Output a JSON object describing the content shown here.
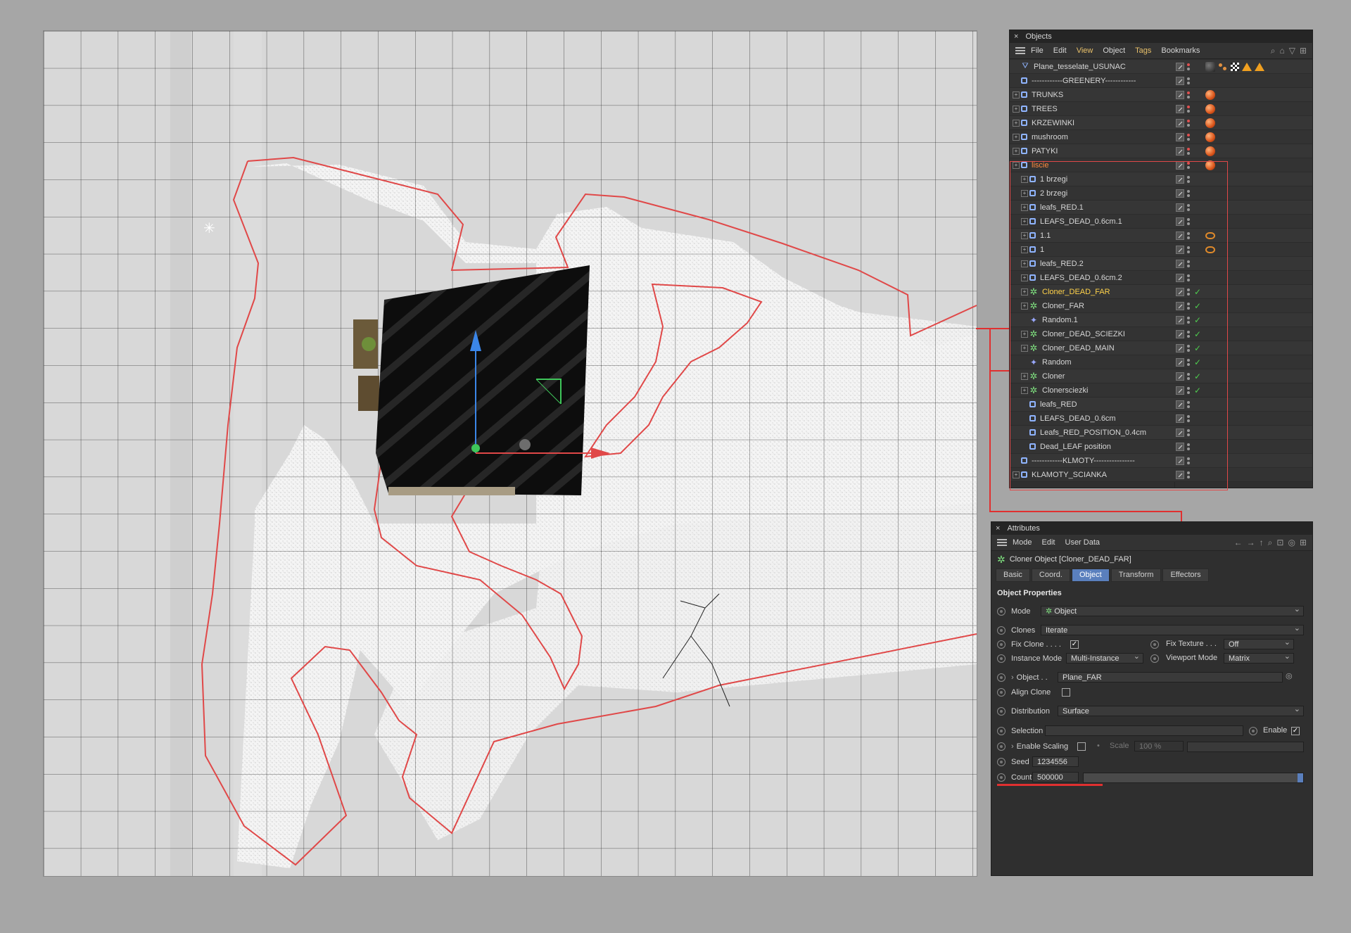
{
  "objects_panel": {
    "title": "Objects",
    "menu": [
      "File",
      "Edit",
      "View",
      "Object",
      "Tags",
      "Bookmarks"
    ],
    "rows": [
      {
        "name": "Plane_tesselate_USUNAC",
        "icon": "plane",
        "expand": false,
        "indent": 0,
        "tags": [
          "dark",
          "dots",
          "checker",
          "tri",
          "tri"
        ],
        "red": true
      },
      {
        "name": "------------GREENERY------------",
        "icon": "null",
        "expand": false,
        "indent": 0,
        "tags": []
      },
      {
        "name": "TRUNKS",
        "icon": "null",
        "expand": true,
        "indent": 0,
        "tags": [
          "mat"
        ],
        "red": true
      },
      {
        "name": "TREES",
        "icon": "null",
        "expand": true,
        "indent": 0,
        "tags": [
          "mat"
        ],
        "red": true
      },
      {
        "name": "KRZEWINKI",
        "icon": "null",
        "expand": true,
        "indent": 0,
        "tags": [
          "mat"
        ],
        "red": true
      },
      {
        "name": "mushroom",
        "icon": "null",
        "expand": true,
        "indent": 0,
        "tags": [
          "mat"
        ],
        "red": true
      },
      {
        "name": "PATYKI",
        "icon": "null",
        "expand": true,
        "indent": 0,
        "tags": [
          "mat"
        ],
        "red": true
      },
      {
        "name": "liscie",
        "icon": "null",
        "expand": true,
        "indent": 0,
        "tags": [
          "mat"
        ],
        "color": "orange",
        "red": true
      },
      {
        "name": "1 brzegi",
        "icon": "null",
        "expand": true,
        "indent": 1,
        "tags": []
      },
      {
        "name": "2 brzegi",
        "icon": "null",
        "expand": true,
        "indent": 1,
        "tags": []
      },
      {
        "name": "leafs_RED.1",
        "icon": "null",
        "expand": true,
        "indent": 1,
        "tags": []
      },
      {
        "name": "LEAFS_DEAD_0.6cm.1",
        "icon": "null",
        "expand": true,
        "indent": 1,
        "tags": []
      },
      {
        "name": "1.1",
        "icon": "null",
        "expand": true,
        "indent": 1,
        "tags": [
          "eye"
        ]
      },
      {
        "name": "1",
        "icon": "null",
        "expand": true,
        "indent": 1,
        "tags": [
          "eye"
        ]
      },
      {
        "name": "leafs_RED.2",
        "icon": "null",
        "expand": true,
        "indent": 1,
        "tags": []
      },
      {
        "name": "LEAFS_DEAD_0.6cm.2",
        "icon": "null",
        "expand": true,
        "indent": 1,
        "tags": []
      },
      {
        "name": "Cloner_DEAD_FAR",
        "icon": "cloner",
        "expand": true,
        "indent": 1,
        "tags": [],
        "color": "yellow",
        "check": true
      },
      {
        "name": "Cloner_FAR",
        "icon": "cloner",
        "expand": true,
        "indent": 1,
        "tags": [],
        "check": true
      },
      {
        "name": "Random.1",
        "icon": "random",
        "expand": false,
        "indent": 1,
        "tags": [],
        "check": true
      },
      {
        "name": "Cloner_DEAD_SCIEZKI",
        "icon": "cloner",
        "expand": true,
        "indent": 1,
        "tags": [],
        "check": true
      },
      {
        "name": "Cloner_DEAD_MAIN",
        "icon": "cloner",
        "expand": true,
        "indent": 1,
        "tags": [],
        "check": true
      },
      {
        "name": "Random",
        "icon": "random",
        "expand": false,
        "indent": 1,
        "tags": [],
        "check": true
      },
      {
        "name": "Cloner",
        "icon": "cloner",
        "expand": true,
        "indent": 1,
        "tags": [],
        "check": true
      },
      {
        "name": "Clonersciezki",
        "icon": "cloner",
        "expand": true,
        "indent": 1,
        "tags": [],
        "check": true
      },
      {
        "name": "leafs_RED",
        "icon": "null",
        "expand": false,
        "indent": 1,
        "tags": []
      },
      {
        "name": "LEAFS_DEAD_0.6cm",
        "icon": "null",
        "expand": false,
        "indent": 1,
        "tags": []
      },
      {
        "name": "Leafs_RED_POSITION_0.4cm",
        "icon": "null",
        "expand": false,
        "indent": 1,
        "tags": []
      },
      {
        "name": "Dead_LEAF position",
        "icon": "null",
        "expand": false,
        "indent": 1,
        "tags": []
      },
      {
        "name": "------------KLMOTY----------------",
        "icon": "null",
        "expand": false,
        "indent": 0,
        "tags": []
      },
      {
        "name": "KLAMOTY_SCIANKA",
        "icon": "null",
        "expand": true,
        "indent": 0,
        "tags": []
      }
    ]
  },
  "attributes_panel": {
    "title": "Attributes",
    "menu": [
      "Mode",
      "Edit",
      "User Data"
    ],
    "object_header": "Cloner Object [Cloner_DEAD_FAR]",
    "tabs": [
      "Basic",
      "Coord.",
      "Object",
      "Transform",
      "Effectors"
    ],
    "active_tab": "Object",
    "section": "Object Properties",
    "mode_label": "Mode",
    "mode_value": "Object",
    "clones_label": "Clones",
    "clones_value": "Iterate",
    "fix_clone_label": "Fix Clone . . . .",
    "fix_clone_checked": true,
    "fix_texture_label": "Fix Texture . . .",
    "fix_texture_value": "Off",
    "instance_mode_label": "Instance Mode",
    "instance_mode_value": "Multi-Instance",
    "viewport_mode_label": "Viewport Mode",
    "viewport_mode_value": "Matrix",
    "object_label": "Object . .",
    "object_value": "Plane_FAR",
    "align_clone_label": "Align Clone",
    "distribution_label": "Distribution",
    "distribution_value": "Surface",
    "selection_label": "Selection",
    "enable_label": "Enable",
    "enable_checked": true,
    "enable_scaling_label": "Enable Scaling",
    "scale_label": "Scale",
    "scale_value": "100 %",
    "seed_label": "Seed",
    "seed_value": "1234556",
    "count_label": "Count",
    "count_value": "500000"
  },
  "colors": {
    "annotation_red": "#e04848",
    "cloner_green": "#7fe07f",
    "active_tab_blue": "#5a7fbd",
    "selected_orange": "#ff8a3d",
    "selected_yellow": "#ffd24a"
  }
}
